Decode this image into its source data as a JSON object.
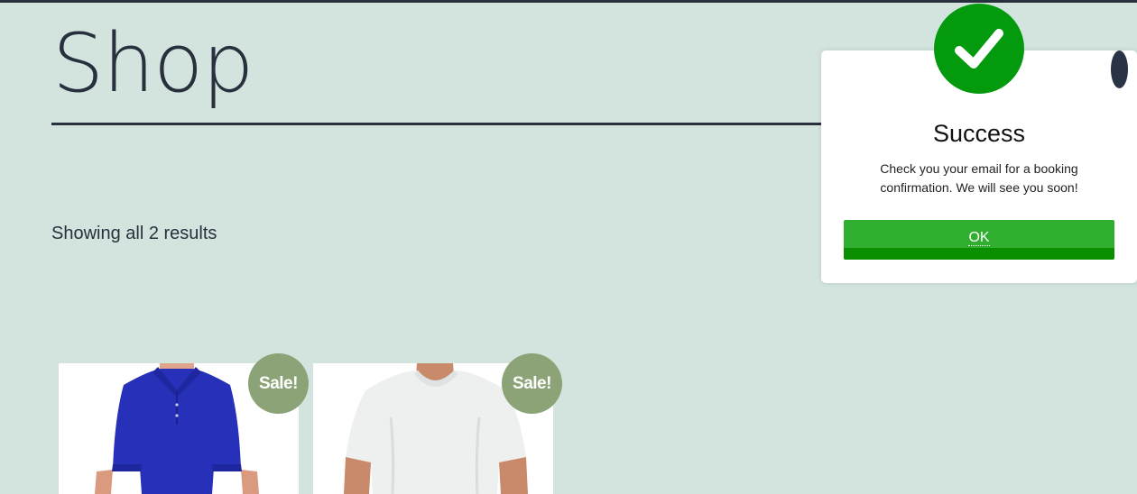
{
  "page": {
    "title": "Shop",
    "result_count": "Showing all 2 results"
  },
  "products": [
    {
      "badge": "Sale!",
      "image": "blue polo shirt",
      "shirt_color": "#2630b8"
    },
    {
      "badge": "Sale!",
      "image": "white t-shirt",
      "shirt_color": "#eef0f0"
    }
  ],
  "modal": {
    "icon": "checkmark-icon",
    "title": "Success",
    "message": "Check you your email for a booking confirmation. We will see you soon!",
    "ok_label": "OK",
    "close_icon": "close-icon"
  },
  "colors": {
    "background": "#d3e4df",
    "text": "#28303d",
    "badge": "#8ba376",
    "success": "#049a0d",
    "ok_button": "#30ae30"
  }
}
